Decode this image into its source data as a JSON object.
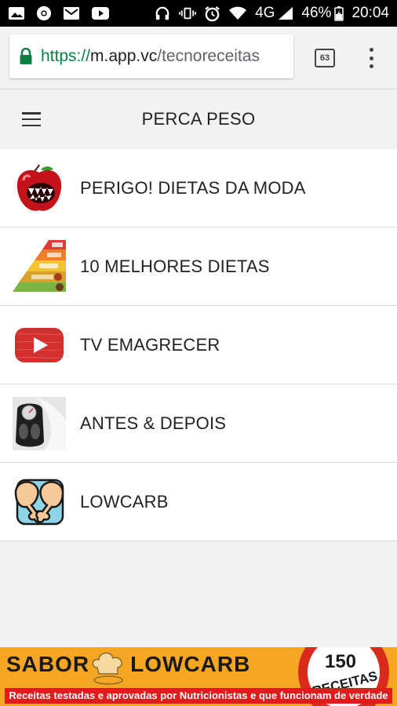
{
  "status_bar": {
    "left_icons": [
      "image-icon",
      "chrome-icon",
      "mail-icon",
      "youtube-icon"
    ],
    "right_icons": [
      "headphones-icon",
      "vibrate-icon",
      "alarm-icon",
      "wifi-icon"
    ],
    "network": "4G",
    "battery": "46%",
    "time": "20:04"
  },
  "browser": {
    "url_scheme": "https://",
    "url_host": "m.app.vc",
    "url_path": "/tecnoreceitas",
    "tab_count": "63",
    "secure_color": "#0b8043"
  },
  "header": {
    "title": "PERCA PESO",
    "menu_icon": "hamburger-menu-icon"
  },
  "list": {
    "items": [
      {
        "label": "PERIGO! DIETAS DA MODA",
        "icon": "apple-monster-icon"
      },
      {
        "label": "10 MELHORES DIETAS",
        "icon": "food-pyramid-icon"
      },
      {
        "label": "TV EMAGRECER",
        "icon": "youtube-play-icon"
      },
      {
        "label": "ANTES & DEPOIS",
        "icon": "bathroom-scale-icon"
      },
      {
        "label": "LOWCARB",
        "icon": "chicken-leg-icon"
      }
    ]
  },
  "banner": {
    "title_part1": "SABOR",
    "title_part2": "LOWCARB",
    "badge_number": "150",
    "badge_text": "RECEITAS",
    "subtitle": "Receitas testadas e aprovadas por Nutricionistas e que funcionam de verdade",
    "bg_color": "#f5a623",
    "sub_color": "#e21b1b"
  }
}
